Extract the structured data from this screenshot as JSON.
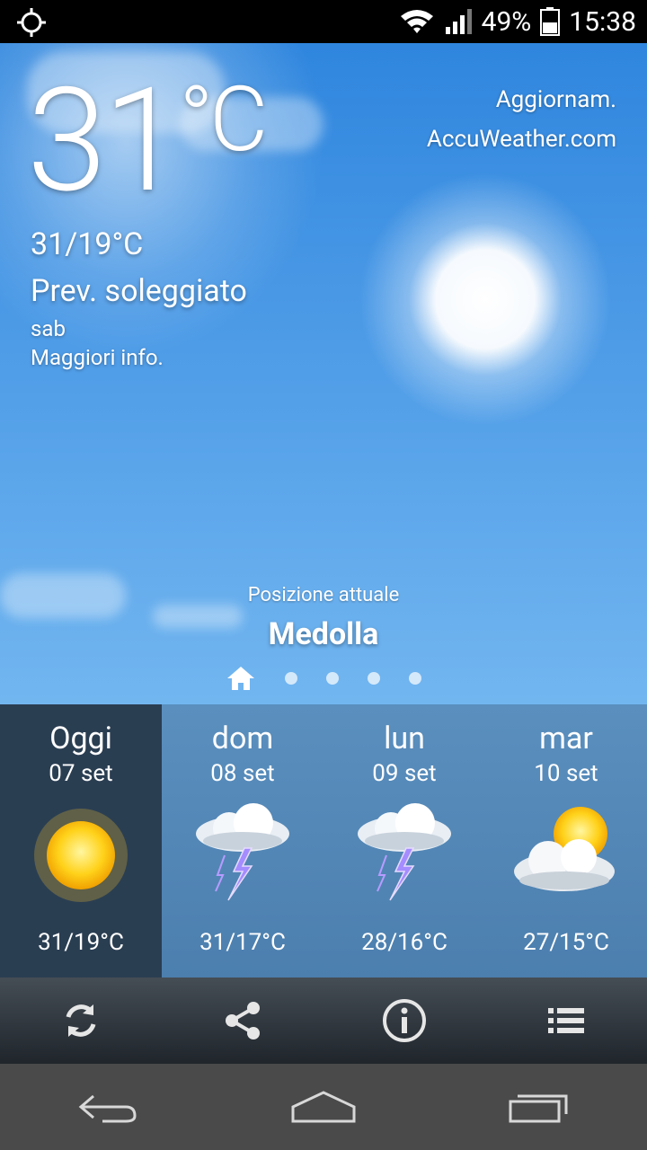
{
  "statusbar": {
    "battery": "49%",
    "time": "15:38",
    "icons": [
      "gps-icon",
      "wifi-icon",
      "signal-icon",
      "battery-icon"
    ]
  },
  "current": {
    "temperature": "31",
    "unit": "°C",
    "range": "31/19°C",
    "condition": "Prev. soleggiato",
    "day": "sab",
    "more_info": "Maggiori info."
  },
  "header": {
    "update_label": "Aggiornam.",
    "source": "AccuWeather.com"
  },
  "location": {
    "label": "Posizione attuale",
    "city": "Medolla"
  },
  "forecast": [
    {
      "day": "Oggi",
      "date": "07 set",
      "icon": "sunny-icon",
      "temps": "31/19°C"
    },
    {
      "day": "dom",
      "date": "08 set",
      "icon": "thunderstorm-icon",
      "temps": "31/17°C"
    },
    {
      "day": "lun",
      "date": "09 set",
      "icon": "thunderstorm-icon",
      "temps": "28/16°C"
    },
    {
      "day": "mar",
      "date": "10 set",
      "icon": "partly-cloudy-icon",
      "temps": "27/15°C"
    }
  ],
  "toolbar": [
    "refresh-icon",
    "share-icon",
    "info-icon",
    "list-icon"
  ],
  "navbar": [
    "back-icon",
    "home-icon",
    "recents-icon"
  ]
}
